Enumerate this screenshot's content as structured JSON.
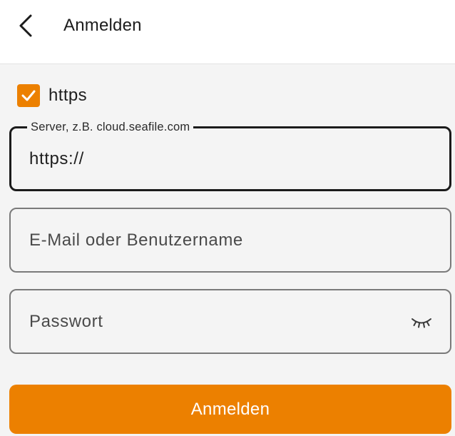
{
  "appbar": {
    "title": "Anmelden",
    "back_icon": "chevron-left-icon"
  },
  "https_option": {
    "label": "https",
    "checked": true,
    "check_icon": "checkmark-icon"
  },
  "server_field": {
    "label": "Server, z.B. cloud.seafile.com",
    "value": "https://"
  },
  "username_field": {
    "placeholder": "E-Mail oder Benutzername",
    "value": ""
  },
  "password_field": {
    "placeholder": "Passwort",
    "value": "",
    "toggle_icon": "eye-closed-icon"
  },
  "login_button": {
    "label": "Anmelden"
  },
  "colors": {
    "accent": "#ec8000",
    "background": "#f4f4f4",
    "appbar": "#ffffff",
    "focused_outline": "#1b1b1b",
    "outline": "#7a7a7a"
  }
}
